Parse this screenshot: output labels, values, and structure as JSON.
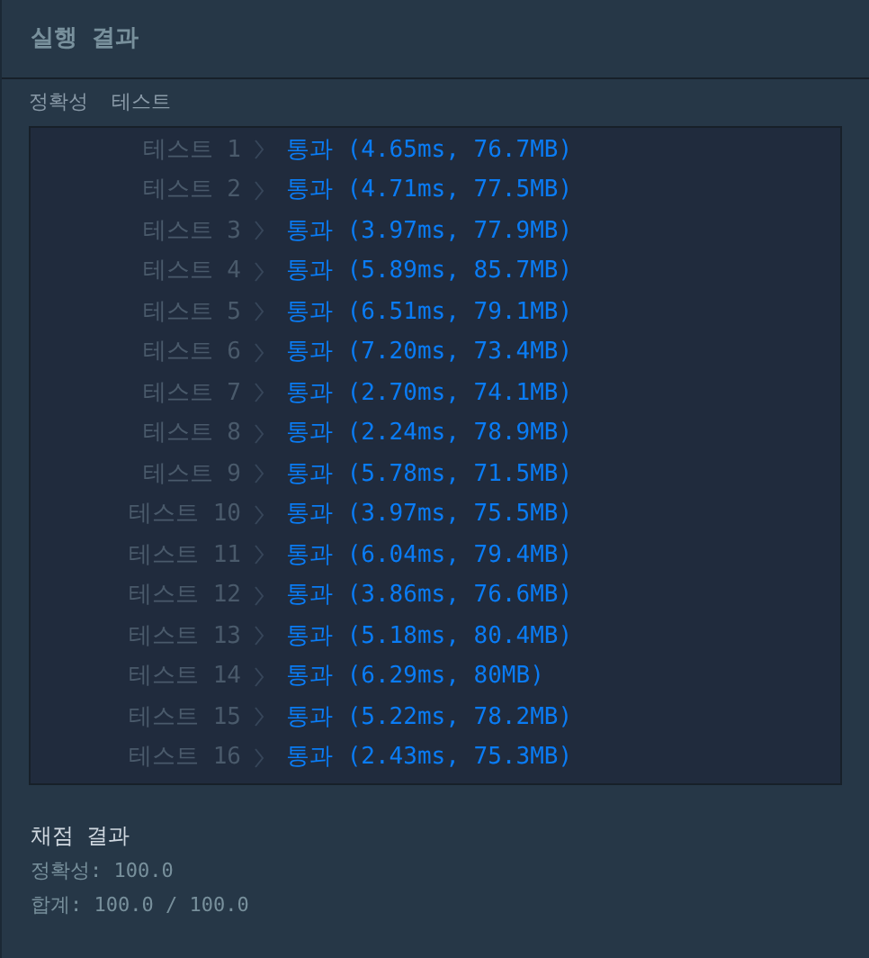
{
  "panel": {
    "title": "실행 결과"
  },
  "section": {
    "title": "정확성  테스트"
  },
  "tests": [
    {
      "label": "테스트 1",
      "result": "통과 (4.65ms, 76.7MB)"
    },
    {
      "label": "테스트 2",
      "result": "통과 (4.71ms, 77.5MB)"
    },
    {
      "label": "테스트 3",
      "result": "통과 (3.97ms, 77.9MB)"
    },
    {
      "label": "테스트 4",
      "result": "통과 (5.89ms, 85.7MB)"
    },
    {
      "label": "테스트 5",
      "result": "통과 (6.51ms, 79.1MB)"
    },
    {
      "label": "테스트 6",
      "result": "통과 (7.20ms, 73.4MB)"
    },
    {
      "label": "테스트 7",
      "result": "통과 (2.70ms, 74.1MB)"
    },
    {
      "label": "테스트 8",
      "result": "통과 (2.24ms, 78.9MB)"
    },
    {
      "label": "테스트 9",
      "result": "통과 (5.78ms, 71.5MB)"
    },
    {
      "label": "테스트 10",
      "result": "통과 (3.97ms, 75.5MB)"
    },
    {
      "label": "테스트 11",
      "result": "통과 (6.04ms, 79.4MB)"
    },
    {
      "label": "테스트 12",
      "result": "통과 (3.86ms, 76.6MB)"
    },
    {
      "label": "테스트 13",
      "result": "통과 (5.18ms, 80.4MB)"
    },
    {
      "label": "테스트 14",
      "result": "통과 (6.29ms, 80MB)"
    },
    {
      "label": "테스트 15",
      "result": "통과 (5.22ms, 78.2MB)"
    },
    {
      "label": "테스트 16",
      "result": "통과 (2.43ms, 75.3MB)"
    }
  ],
  "summary": {
    "title": "채점 결과",
    "lines": [
      "정확성: 100.0",
      "합계: 100.0 / 100.0"
    ]
  }
}
